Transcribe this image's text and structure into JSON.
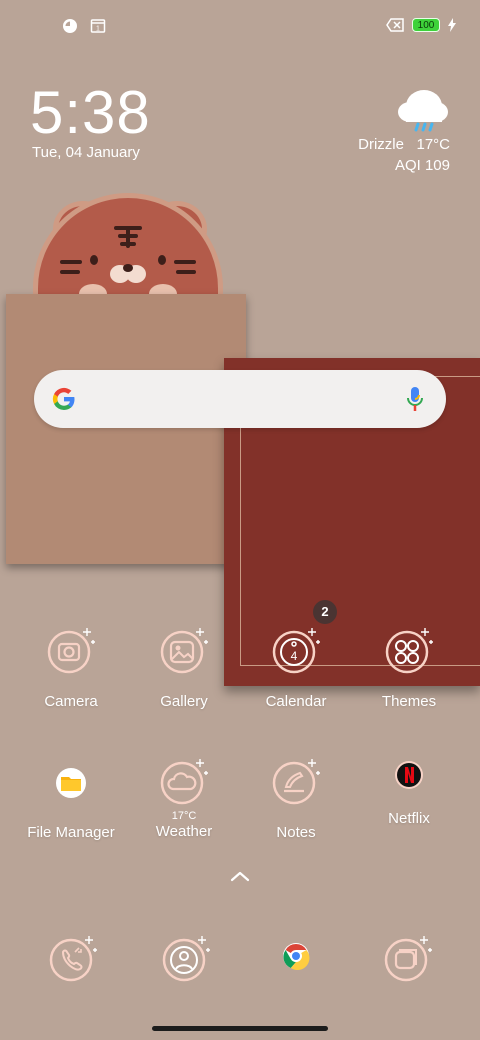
{
  "status_bar": {
    "left_icons": [
      "app-notification-icon",
      "calendar-notification-icon"
    ],
    "right_icons": [
      "no-sim-icon",
      "battery-icon",
      "charging-icon"
    ],
    "battery_level": "100"
  },
  "clock": {
    "time": "5:38",
    "date": "Tue, 04 January"
  },
  "weather_widget": {
    "icon": "drizzle-cloud-icon",
    "condition": "Drizzle",
    "temperature": "17°C",
    "aqi": "AQI 109"
  },
  "search_bar": {
    "logo": "google-g-icon",
    "mic": "microphone-icon"
  },
  "apps": [
    {
      "label": "Camera"
    },
    {
      "label": "Gallery"
    },
    {
      "label": "Calendar",
      "badge": "2",
      "day": "4"
    },
    {
      "label": "Themes"
    },
    {
      "label": "File Manager"
    },
    {
      "label": "Weather",
      "temp": "17°C"
    },
    {
      "label": "Notes"
    },
    {
      "label": "Netflix"
    }
  ],
  "drawer_handle": "chevron-up-icon",
  "dock": [
    "phone-icon",
    "contacts-icon",
    "chrome-icon",
    "messages-icon"
  ],
  "colors": {
    "background": "#b9a497",
    "icon_outline": "#f7d2c6",
    "wallpaper_red": "#823129",
    "battery_green": "#3ed23a"
  }
}
